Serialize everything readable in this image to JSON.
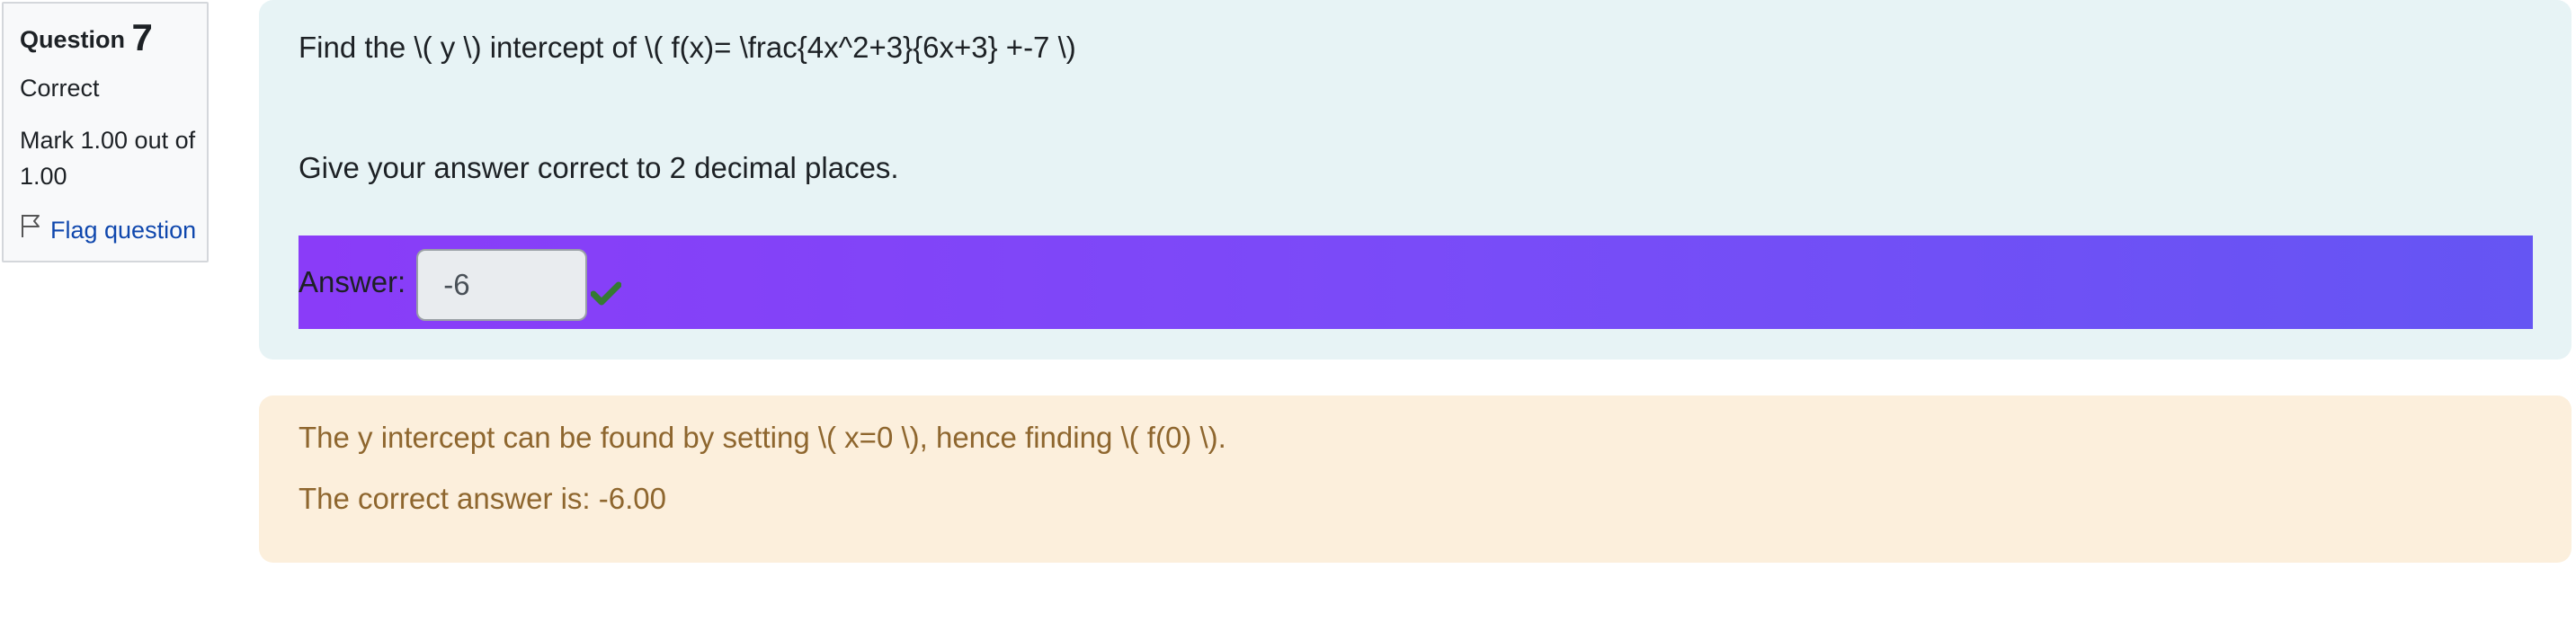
{
  "info": {
    "question_label": "Question",
    "question_number": "7",
    "state": "Correct",
    "grade": "Mark 1.00 out of 1.00",
    "flag_label": "Flag question"
  },
  "formulation": {
    "question_text": "Find the \\( y \\) intercept of \\( f(x)= \\frac{4x^2+3}{6x+3} +-7 \\)",
    "instruction": "Give your answer correct to 2 decimal places.",
    "answer_label": "Answer:",
    "answer_value": "-6"
  },
  "feedback": {
    "general": "The y intercept can be found by setting \\( x=0 \\), hence finding \\( f(0) \\).",
    "right_answer": "The correct answer is: -6.00"
  },
  "colors": {
    "formulation_bg": "#e7f3f5",
    "feedback_bg": "#fcefdc",
    "answer_bar_start": "#8a3cf8",
    "answer_bar_end": "#6555f3",
    "check_color": "#357a32",
    "link_color": "#0f47ad"
  },
  "icons": {
    "flag": "flag-outline-icon",
    "correct": "check-icon"
  }
}
